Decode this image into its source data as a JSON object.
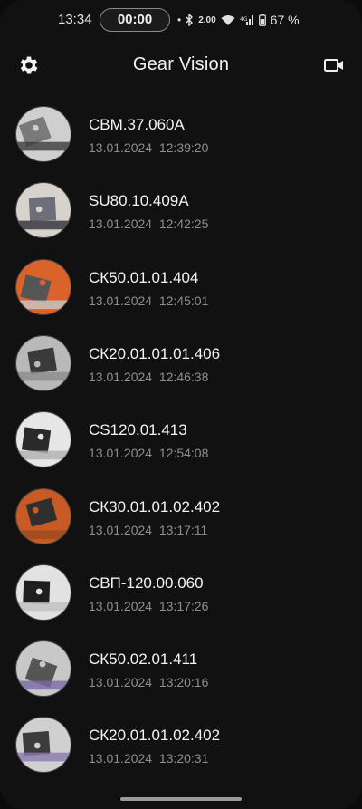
{
  "status_bar": {
    "time": "13:34",
    "timer": "00:00",
    "net_speed": "2.00",
    "battery": "67 %"
  },
  "header": {
    "title": "Gear Vision",
    "settings_icon": "gear-icon",
    "camera_icon": "video-camera-icon"
  },
  "items": [
    {
      "name": "СВМ.37.060А",
      "date": "13.01.2024",
      "time": "12:39:20",
      "colors": [
        "#cfcfcf",
        "#7a7a7a",
        "#3b3b3b"
      ]
    },
    {
      "name": "SU80.10.409А",
      "date": "13.01.2024",
      "time": "12:42:25",
      "colors": [
        "#d8d2cc",
        "#6c6e78",
        "#2e2e38"
      ]
    },
    {
      "name": "СК50.01.01.404",
      "date": "13.01.2024",
      "time": "12:45:01",
      "colors": [
        "#d9632a",
        "#555555",
        "#c8c8c8"
      ]
    },
    {
      "name": "СК20.01.01.01.406",
      "date": "13.01.2024",
      "time": "12:46:38",
      "colors": [
        "#b9b9b9",
        "#3a3a3a",
        "#8c8c8c"
      ]
    },
    {
      "name": "CS120.01.413",
      "date": "13.01.2024",
      "time": "12:54:08",
      "colors": [
        "#e6e6e6",
        "#2a2a2a",
        "#b0b0b0"
      ]
    },
    {
      "name": "СК30.01.01.02.402",
      "date": "13.01.2024",
      "time": "13:17:11",
      "colors": [
        "#c85a25",
        "#2f2f2f",
        "#9a4a20"
      ]
    },
    {
      "name": "СВП-120.00.060",
      "date": "13.01.2024",
      "time": "13:17:26",
      "colors": [
        "#e2e2e2",
        "#1e1e1e",
        "#c0c0c0"
      ]
    },
    {
      "name": "СК50.02.01.411",
      "date": "13.01.2024",
      "time": "13:20:16",
      "colors": [
        "#c8c8c8",
        "#555555",
        "#7a6aa8"
      ]
    },
    {
      "name": "СК20.01.01.02.402",
      "date": "13.01.2024",
      "time": "13:20:31",
      "colors": [
        "#d0d0d0",
        "#3c3c3c",
        "#8a7bb0"
      ]
    }
  ]
}
